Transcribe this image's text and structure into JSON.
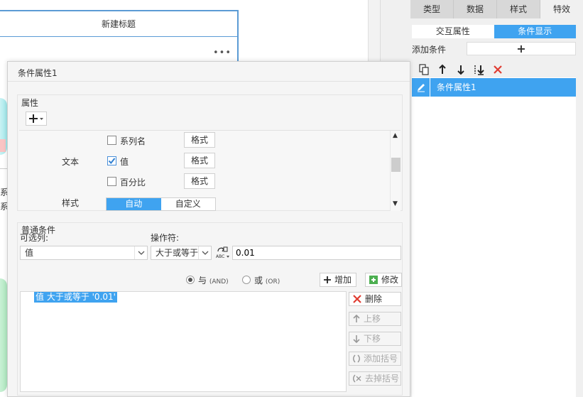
{
  "background": {
    "chart_title": "新建标题",
    "more_icon": "•••",
    "peek_labels": [
      "系",
      "系"
    ]
  },
  "side_panel": {
    "tabs": [
      {
        "label": "类型",
        "active": false
      },
      {
        "label": "数据",
        "active": false
      },
      {
        "label": "样式",
        "active": false
      },
      {
        "label": "特效",
        "active": true
      }
    ],
    "subtabs": [
      {
        "label": "交互属性",
        "active": false
      },
      {
        "label": "条件显示",
        "active": true
      }
    ],
    "add_condition_label": "添加条件",
    "add_condition_button": "+",
    "toolbar_icons": [
      "copy-icon",
      "arrow-up-icon",
      "arrow-down-icon",
      "sort-icon",
      "delete-icon"
    ],
    "list_items": [
      {
        "label": "条件属性1",
        "selected": true
      }
    ]
  },
  "dialog": {
    "title": "条件属性1",
    "attributes": {
      "title": "属性",
      "add_button": "+▾",
      "text_label": "文本",
      "style_label": "样式",
      "checkboxes": [
        {
          "label": "系列名",
          "checked": false,
          "format": "格式"
        },
        {
          "label": "值",
          "checked": true,
          "format": "格式"
        },
        {
          "label": "百分比",
          "checked": false,
          "format": "格式"
        }
      ],
      "style_options": [
        {
          "label": "自动",
          "active": true
        },
        {
          "label": "自定义",
          "active": false
        }
      ]
    },
    "condition": {
      "title": "普通条件",
      "column_label": "可选列:",
      "operator_label": "操作符:",
      "column_value": "值",
      "operator_value": "大于或等于",
      "value_type_label": "ABC",
      "value": "0.01",
      "logic": [
        {
          "label": "与",
          "sub": "(AND)",
          "checked": true
        },
        {
          "label": "或",
          "sub": "(OR)",
          "checked": false
        }
      ],
      "buttons": {
        "add": "增加",
        "modify": "修改",
        "delete": "删除",
        "up": "上移",
        "down": "下移",
        "add_bracket": "添加括号",
        "remove_bracket": "去掉括号"
      },
      "items": [
        "值 大于或等于 '0.01'"
      ]
    }
  },
  "colors": {
    "accent": "#3fa3f0",
    "delete_red": "#e03c31",
    "panel_bg": "#f0f0f0",
    "chart_border": "#5b9bd5"
  }
}
